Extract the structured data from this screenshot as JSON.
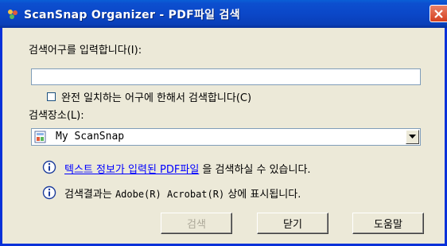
{
  "window": {
    "title": "ScanSnap Organizer - PDF파일 검색"
  },
  "search": {
    "prompt_label": "검색어구를 입력합니다(I):",
    "input_value": "",
    "exact_match_label": "완전 일치하는 어구에 한해서 검색합니다(C)",
    "exact_match_checked": false
  },
  "location": {
    "label": "검색장소(L):",
    "selected": "My ScanSnap"
  },
  "info": {
    "line1_link": "텍스트 정보가 입력된 PDF파일",
    "line1_rest": " 을 검색하실 수 있습니다.",
    "line2_prefix": "검색결과는 ",
    "line2_app": "Adobe(R) Acrobat(R)",
    "line2_suffix": " 상에 표시됩니다."
  },
  "buttons": {
    "search": "검색",
    "close": "닫기",
    "help": "도움말"
  },
  "colors": {
    "titlebar": "#0a47c8",
    "dialog_bg": "#ece9d8",
    "link": "#0000ff",
    "close_button": "#d4401f"
  }
}
